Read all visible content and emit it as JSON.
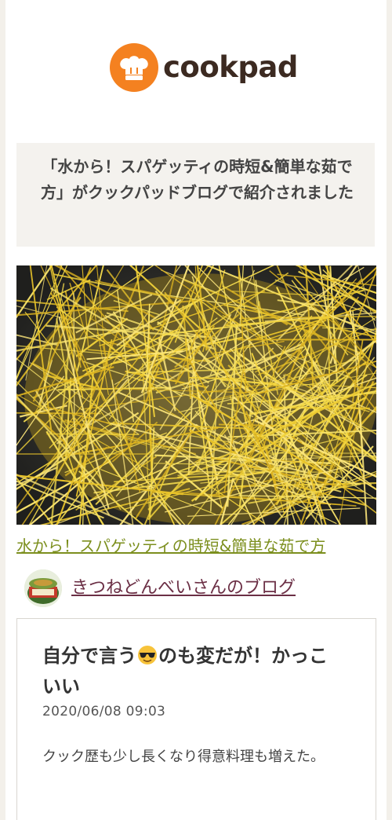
{
  "header": {
    "logo_text": "cookpad",
    "logo_icon": "chef-hat-icon",
    "brand_color": "#f48120"
  },
  "notice": {
    "text": "「水から！スパゲッティの時短&簡単な茹で方」がクックパッドブログで紹介されました"
  },
  "recipe": {
    "photo": "spaghetti-photo",
    "link_text": "水から！スパゲッティの時短&簡単な茹で方",
    "link_color": "#7c8f1e"
  },
  "blog": {
    "name": "きつねどんべいさんのブログ",
    "avatar": "kitsune-donbei-avatar",
    "name_color": "#6b2f45"
  },
  "post": {
    "title_part1": "自分で言う",
    "emoji": "sunglasses-emoji",
    "title_part2": "のも変だが！かっこいい",
    "date": "2020/06/08 09:03",
    "body": "クック歴も少し長くなり得意料理も増えた。"
  }
}
